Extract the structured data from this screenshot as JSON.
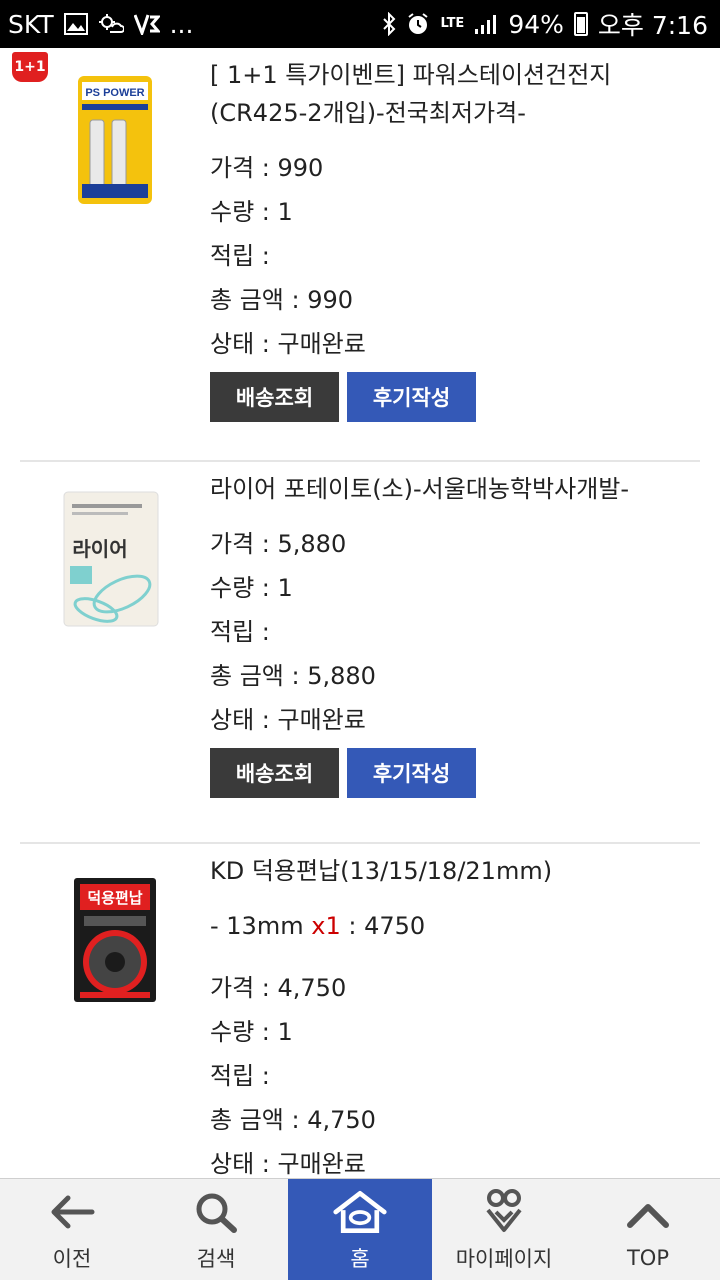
{
  "status_bar": {
    "carrier": "SKT",
    "more": "...",
    "network": "LTE",
    "battery": "94%",
    "time": "오후 7:16"
  },
  "orders": [
    {
      "badge": "1+1",
      "title": "[ 1+1 특가이벤트] 파워스테이션건전지(CR425-2개입)-전국최저가격-",
      "price": "가격 : 990",
      "quantity": "수량 : 1",
      "points": "적립 :",
      "total": "총 금액 : 990",
      "status": "상태 : 구매완료",
      "shipping_button": "배송조회",
      "review_button": "후기작성",
      "product_image_text": "PS POWER"
    },
    {
      "title": "라이어 포테이토(소)-서울대농학박사개발-",
      "price": "가격 : 5,880",
      "quantity": "수량 : 1",
      "points": "적립 :",
      "total": "총 금액 : 5,880",
      "status": "상태 : 구매완료",
      "shipping_button": "배송조회",
      "review_button": "후기작성",
      "product_image_text": "라이어"
    },
    {
      "title": "KD 덕용편납(13/15/18/21mm)",
      "option_prefix": "- 13mm",
      "option_qty": "x1",
      "option_price": ": 4750",
      "price": "가격 : 4,750",
      "quantity": "수량 : 1",
      "points": "적립 :",
      "total": "총 금액 : 4,750",
      "status": "상태 : 구매완료",
      "product_image_text": "덕용편납"
    }
  ],
  "bottom_nav": {
    "items": [
      {
        "label": "이전",
        "icon": "arrow-left-icon"
      },
      {
        "label": "검색",
        "icon": "search-icon"
      },
      {
        "label": "홈",
        "icon": "home-icon",
        "active": true
      },
      {
        "label": "마이페이지",
        "icon": "mypage-icon"
      },
      {
        "label": "TOP",
        "icon": "chevron-up-icon"
      }
    ]
  },
  "colors": {
    "accent_blue": "#3459b7",
    "button_dark": "#3a3a3a",
    "badge_red": "#e02020"
  }
}
